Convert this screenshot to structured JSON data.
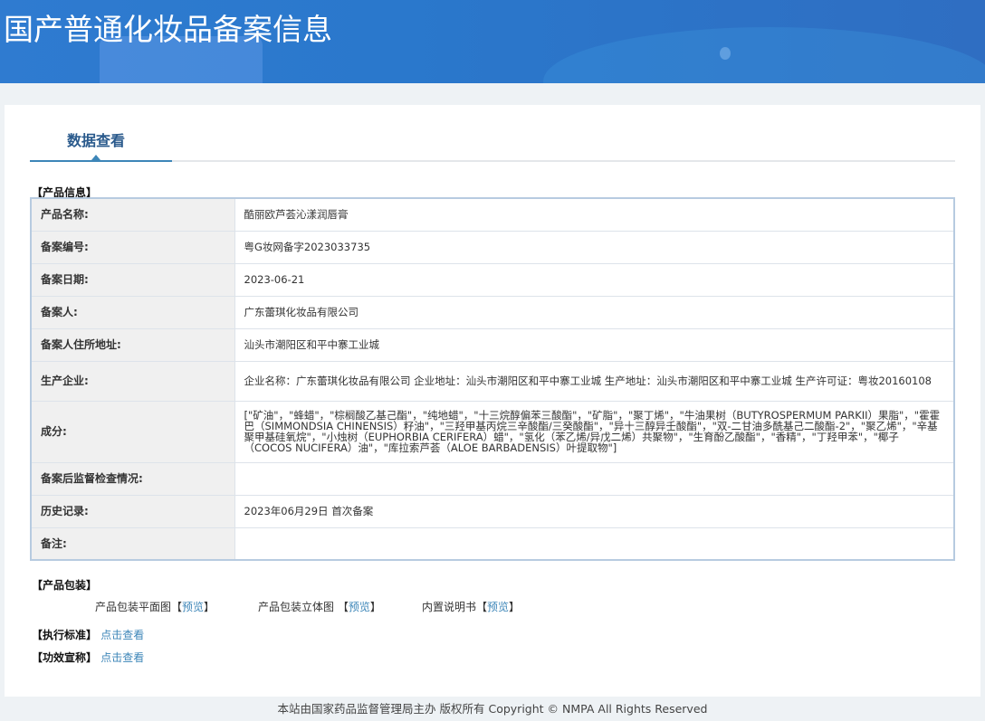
{
  "header": {
    "title": "国产普通化妆品备案信息"
  },
  "tabs": [
    {
      "label": "数据查看",
      "active": true
    }
  ],
  "product_info": {
    "section_label": "【产品信息】",
    "rows": [
      {
        "label": "产品名称:",
        "value": "酷丽欧芦荟沁漾润唇膏"
      },
      {
        "label": "备案编号:",
        "value": "粤G妆网备字2023033735"
      },
      {
        "label": "备案日期:",
        "value": "2023-06-21"
      },
      {
        "label": "备案人:",
        "value": "广东蕾琪化妆品有限公司"
      },
      {
        "label": "备案人住所地址:",
        "value": "汕头市潮阳区和平中寨工业城"
      },
      {
        "label": "生产企业:",
        "value": "企业名称：广东蕾琪化妆品有限公司 企业地址：汕头市潮阳区和平中寨工业城 生产地址：汕头市潮阳区和平中寨工业城 生产许可证：粤妆20160108"
      },
      {
        "label": "成分:",
        "value": "[\"矿油\"，\"蜂蜡\"，\"棕榈酸乙基己酯\"，\"纯地蜡\"，\"十三烷醇偏苯三酸酯\"，\"矿脂\"，\"聚丁烯\"，\"牛油果树（BUTYROSPERMUM PARKII）果脂\"，\"霍霍巴（SIMMONDSIA CHINENSIS）籽油\"，\"三羟甲基丙烷三辛酸酯/三癸酸酯\"，\"异十三醇异壬酸酯\"，\"双-二甘油多酰基己二酸酯-2\"，\"聚乙烯\"，\"辛基聚甲基硅氧烷\"，\"小烛树（EUPHORBIA CERIFERA）蜡\"，\"氢化（苯乙烯/异戊二烯）共聚物\"，\"生育酚乙酸酯\"，\"香精\"，\"丁羟甲苯\"，\"椰子（COCOS NUCIFERA）油\"，\"库拉索芦荟（ALOE BARBADENSIS）叶提取物\"]"
      },
      {
        "label": "备案后监督检查情况:",
        "value": ""
      },
      {
        "label": "历史记录:",
        "value": "2023年06月29日 首次备案"
      },
      {
        "label": "备注:",
        "value": ""
      }
    ]
  },
  "packaging": {
    "section_label": "【产品包装】",
    "items": [
      {
        "label": "产品包装平面图",
        "open": "【",
        "link": "预览",
        "close": "】"
      },
      {
        "label": "产品包装立体图 ",
        "open": "【",
        "link": "预览",
        "close": "】"
      },
      {
        "label": "内置说明书",
        "open": "【",
        "link": "预览",
        "close": "】"
      }
    ]
  },
  "standard": {
    "label": "【执行标准】",
    "link": "点击查看"
  },
  "efficacy": {
    "label": "【功效宣称】",
    "link": "点击查看"
  },
  "footer": {
    "text": "本站由国家药品监督管理局主办 版权所有 Copyright © NMPA All Rights Reserved"
  }
}
